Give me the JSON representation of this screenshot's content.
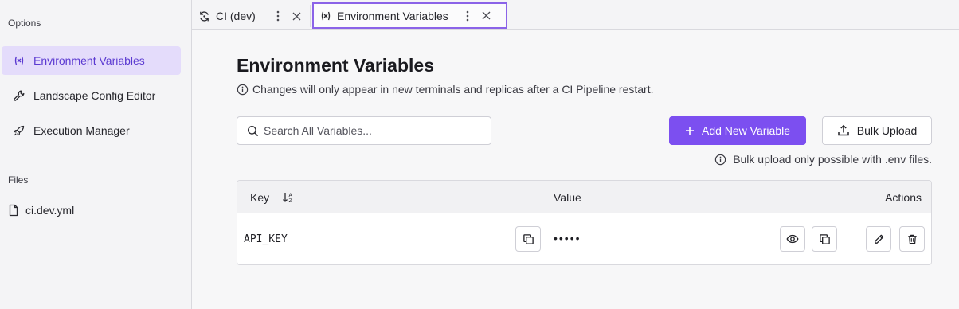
{
  "sidebar": {
    "options_label": "Options",
    "items": [
      {
        "label": "Environment Variables",
        "icon": "variable-icon",
        "active": true
      },
      {
        "label": "Landscape Config Editor",
        "icon": "wrench-icon",
        "active": false
      },
      {
        "label": "Execution Manager",
        "icon": "rocket-icon",
        "active": false
      }
    ],
    "files_label": "Files",
    "files": [
      {
        "label": "ci.dev.yml",
        "icon": "file-icon"
      }
    ]
  },
  "tabs": [
    {
      "label": "CI (dev)",
      "icon": "refresh-icon",
      "active": false
    },
    {
      "label": "Environment Variables",
      "icon": "variable-icon",
      "active": true
    }
  ],
  "main": {
    "title": "Environment Variables",
    "info": "Changes will only appear in new terminals and replicas after a CI Pipeline restart.",
    "search": {
      "placeholder": "Search All Variables...",
      "value": ""
    },
    "add_button": "Add New Variable",
    "bulk_button": "Bulk Upload",
    "bulk_note": "Bulk upload only possible with .env files."
  },
  "table": {
    "headers": {
      "key": "Key",
      "value": "Value",
      "actions": "Actions"
    },
    "rows": [
      {
        "key": "API_KEY",
        "value": "•••••"
      }
    ]
  },
  "colors": {
    "accent": "#7c4ff0",
    "active_bg": "#e4dcfb",
    "active_text": "#5b3ad1",
    "tab_border": "#8b63e8"
  }
}
